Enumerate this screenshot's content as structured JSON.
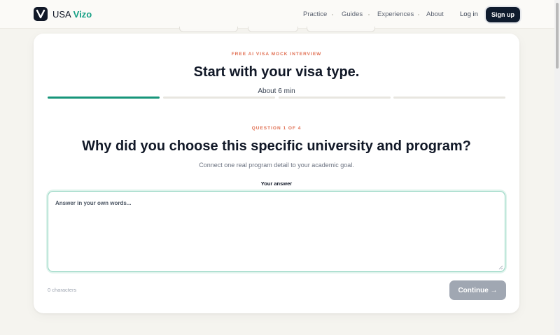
{
  "nav": {
    "brand_prefix": "USA",
    "brand_accent": "Vizo",
    "links": [
      "Practice",
      "Guides",
      "Experiences",
      "About"
    ],
    "login": "Log in",
    "signup": "Sign up"
  },
  "card": {
    "eyebrow": "FREE AI VISA MOCK INTERVIEW",
    "title": "Start with your visa type.",
    "duration": "About 6 min",
    "progress": {
      "current_step": 1,
      "total_steps": 4
    },
    "question_counter": "QUESTION 1 OF 4",
    "question": "Why did you choose this specific university and program?",
    "hint": "Connect one real program detail to your academic goal.",
    "answer_label": "Your answer",
    "answer_placeholder": "Answer in your own words...",
    "answer_value": "",
    "char_count": "0 characters",
    "continue_label": "Continue →"
  },
  "colors": {
    "accent": "#17957a",
    "eyebrow": "#e06f52",
    "primary_dark": "#0f1b2d",
    "disabled_button": "#a0a7b2"
  },
  "icons": [
    "logo-v-icon",
    "resize-handle-icon"
  ]
}
